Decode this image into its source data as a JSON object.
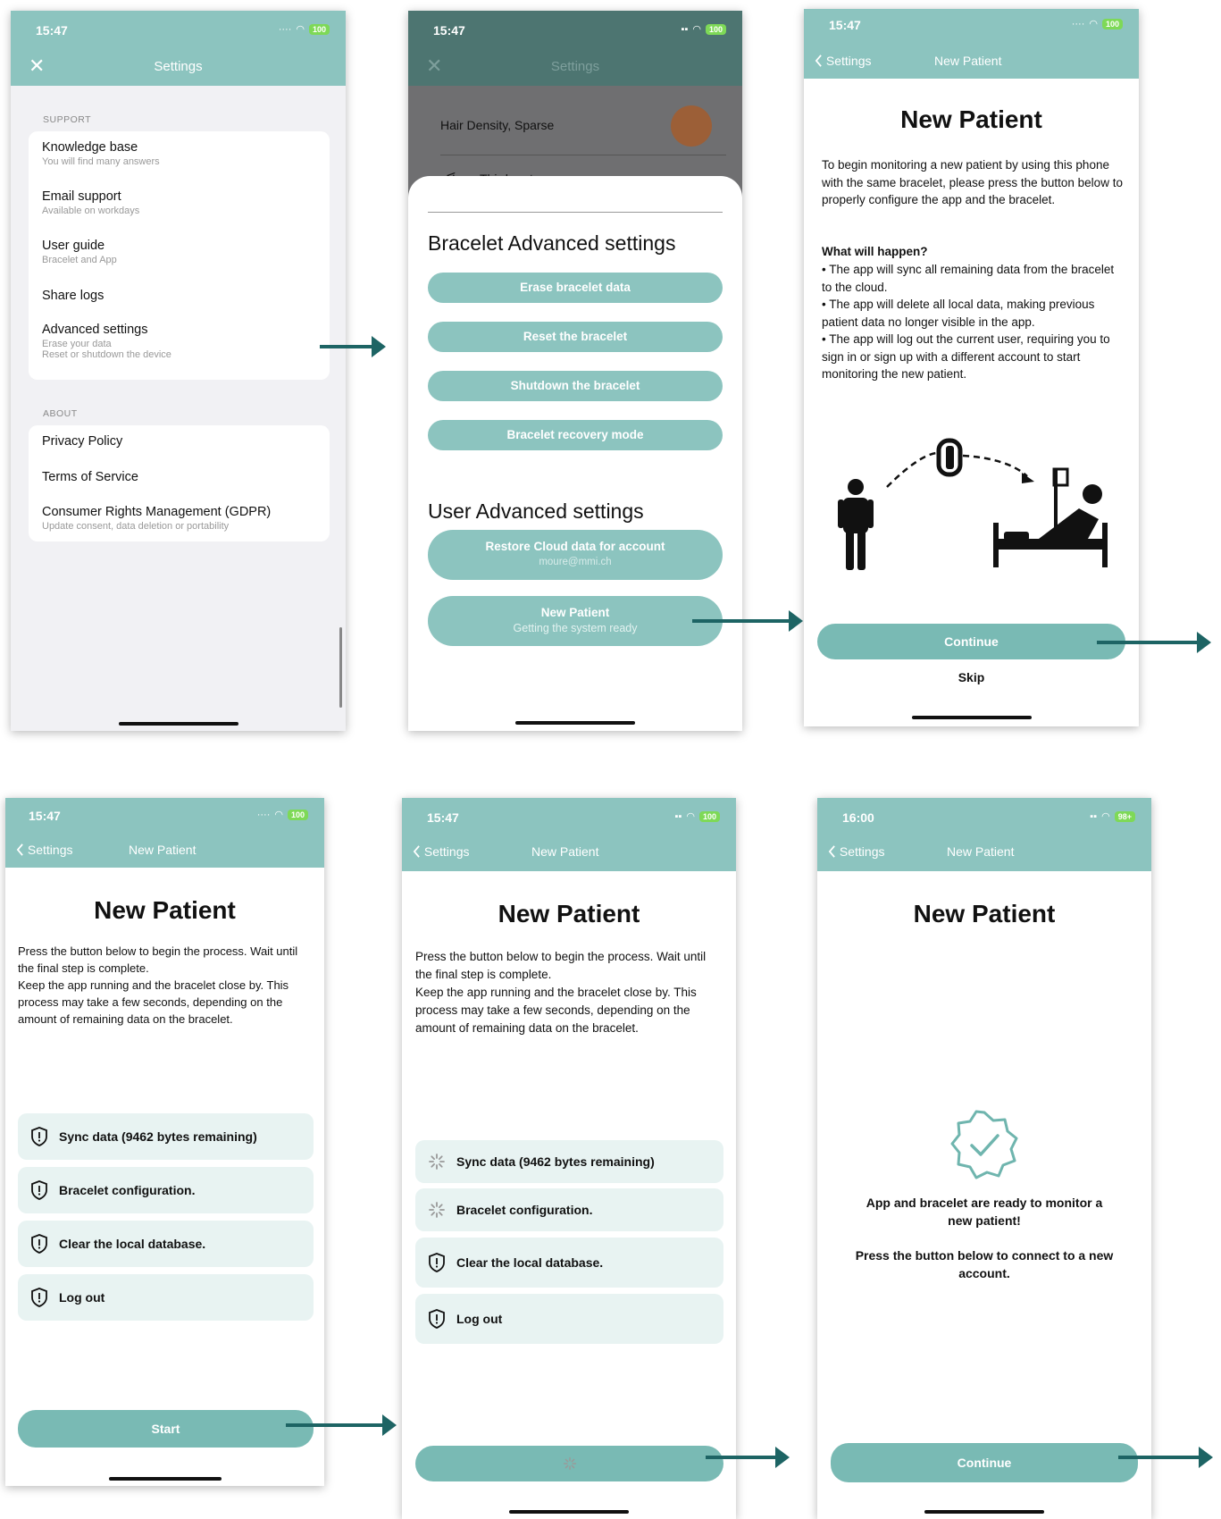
{
  "status": {
    "time_a": "15:47",
    "time_b": "16:00",
    "battery_a": "100",
    "battery_b": "98+"
  },
  "screen1": {
    "title": "Settings",
    "support_label": "SUPPORT",
    "items": [
      {
        "label": "Knowledge base",
        "sub": "You will find many answers"
      },
      {
        "label": "Email support",
        "sub": "Available on workdays"
      },
      {
        "label": "User guide",
        "sub": "Bracelet and App"
      },
      {
        "label": "Share logs",
        "sub": ""
      },
      {
        "label": "Advanced settings",
        "sub": "Erase your data",
        "sub2": "Reset or shutdown the device"
      }
    ],
    "about_label": "ABOUT",
    "about_items": [
      {
        "label": "Privacy Policy",
        "sub": ""
      },
      {
        "label": "Terms of Service",
        "sub": ""
      },
      {
        "label": "Consumer Rights Management (GDPR)",
        "sub": "Update consent, data deletion or portability"
      }
    ]
  },
  "screen2": {
    "title": "Settings",
    "bg_item1": "Hair Density, Sparse",
    "bg_item2": "Third party apps",
    "bracelet_heading": "Bracelet Advanced settings",
    "bracelet_buttons": [
      "Erase bracelet data",
      "Reset the bracelet",
      "Shutdown the bracelet",
      "Bracelet recovery mode"
    ],
    "user_heading": "User Advanced settings",
    "restore_label": "Restore Cloud data for account",
    "restore_sub": "moure@mmi.ch",
    "new_patient_label": "New Patient",
    "new_patient_sub": "Getting the system ready"
  },
  "screen3": {
    "back": "Settings",
    "nav_title": "New Patient",
    "heading": "New Patient",
    "intro": "To begin monitoring a new patient by using this phone with the same bracelet, please press the button below to properly configure the app and the bracelet.",
    "what_heading": "What will happen?",
    "bullets": [
      "• The app will sync all remaining data from the bracelet to the cloud.",
      "• The app will delete all local data, making previous patient data no longer visible in the app.",
      "• The app will log out the current user, requiring you to sign in or sign up with a different account to start monitoring the new patient."
    ],
    "continue": "Continue",
    "skip": "Skip"
  },
  "screen4": {
    "back": "Settings",
    "nav_title": "New Patient",
    "heading": "New Patient",
    "intro": "Press the button below to begin the process. Wait until the final step is complete.\nKeep the app running and the bracelet close by. This process may take a few seconds, depending on the amount of remaining data on the bracelet.",
    "steps": [
      "Sync data (9462 bytes remaining)",
      "Bracelet configuration.",
      "Clear the local database.",
      "Log out"
    ],
    "start": "Start"
  },
  "screen5": {
    "back": "Settings",
    "nav_title": "New Patient",
    "heading": "New Patient",
    "intro": "Press the button below to begin the process. Wait until the final step is complete.\nKeep the app running and the bracelet close by. This process may take a few seconds, depending on the amount of remaining data on the bracelet.",
    "steps": [
      "Sync data (9462 bytes remaining)",
      "Bracelet configuration.",
      "Clear the local database.",
      "Log out"
    ]
  },
  "screen6": {
    "back": "Settings",
    "nav_title": "New Patient",
    "heading": "New Patient",
    "ready_msg": "App and bracelet are ready to monitor a new patient!",
    "connect_msg": "Press the button below to connect to a new account.",
    "continue": "Continue"
  },
  "colors": {
    "header": "#8cc4bf",
    "button": "#79bab4",
    "row_bg": "#e8f3f2",
    "arrow": "#1d6464"
  }
}
